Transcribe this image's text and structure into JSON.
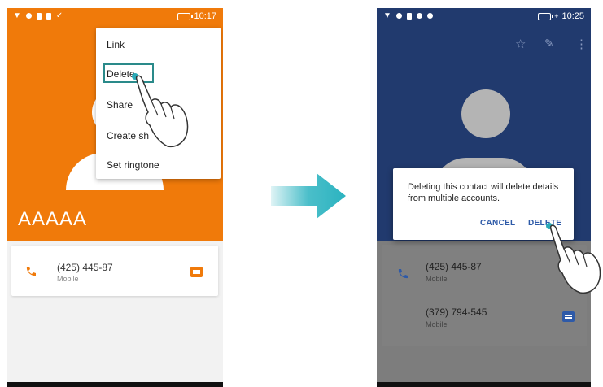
{
  "left_screen": {
    "status": {
      "time": "10:17"
    },
    "contact_name": "AAAAA",
    "menu_items": [
      "Link",
      "Delete",
      "Share",
      "Create sh",
      "Set ringtone"
    ],
    "phone_entry": {
      "number": "(425) 445-87",
      "type": "Mobile"
    },
    "colors": {
      "header": "#f07a0a",
      "accent": "#f07a0a"
    }
  },
  "right_screen": {
    "status": {
      "time": "10:25"
    },
    "dialog": {
      "message": "Deleting this contact will delete details from multiple accounts.",
      "cancel_label": "CANCEL",
      "delete_label": "DELETE"
    },
    "phone_entries": [
      {
        "number": "(425) 445-87",
        "type": "Mobile"
      },
      {
        "number": "(379) 794-545",
        "type": "Mobile"
      }
    ],
    "colors": {
      "header": "#213a6e",
      "accent": "#2e5aa8"
    }
  },
  "arrow": {
    "color": "#2bb3c0"
  }
}
